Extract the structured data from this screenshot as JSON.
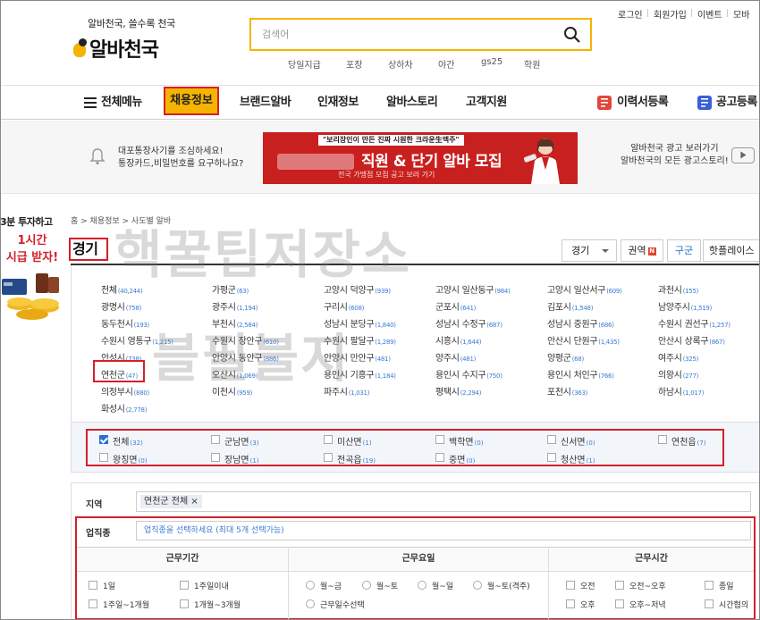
{
  "header": {
    "tagline": "알바천국, 쓸수록 천국",
    "logo_text": "알바천국",
    "search_placeholder": "검색어",
    "keywords": [
      "당일지급",
      "포장",
      "상하차",
      "야간",
      "gs25",
      "학원"
    ],
    "util_links": [
      "로그인",
      "회원가입",
      "이벤트",
      "모바"
    ]
  },
  "nav": {
    "menu_label": "전체메뉴",
    "items": [
      "채용정보",
      "브랜드알바",
      "인재정보",
      "알바스토리",
      "고객지원"
    ],
    "resume_label": "이력서등록",
    "post_label": "공고등록"
  },
  "banner": {
    "notice_line1": "대포통장사기를 조심하세요!",
    "notice_line2": "통장카드,비밀번호를 요구하나요?",
    "ad_top": "\"보리장인이 만든 진짜 시원한 크라운生맥주\"",
    "ad_main": "직원 & 단기 알바 모집",
    "ad_sub": "전국 가맹점 모집 공고 보러 가기",
    "right_line1": "알바천국 광고 보러가기",
    "right_line2": "알바천국의 모든 광고스토리!"
  },
  "side_ad": {
    "line1": "3분 투자하고",
    "line2": "1시간",
    "line3": "시급 받자!"
  },
  "breadcrumb": "홈 > 채용정보 > 사도별 알바",
  "page_title": "경기",
  "region_select": "경기",
  "tabs": [
    "권역",
    "구군",
    "핫플레이스"
  ],
  "tab_badge": "N",
  "cities": [
    [
      "전체",
      "40,244"
    ],
    [
      "가평군",
      "63"
    ],
    [
      "고양시 덕양구",
      "939"
    ],
    [
      "고양시 일산동구",
      "984"
    ],
    [
      "고양시 일산서구",
      "609"
    ],
    [
      "과천시",
      "155"
    ],
    [
      "광명시",
      "758"
    ],
    [
      "광주시",
      "1,194"
    ],
    [
      "구리시",
      "608"
    ],
    [
      "군포시",
      "641"
    ],
    [
      "김포시",
      "1,548"
    ],
    [
      "남양주시",
      "1,519"
    ],
    [
      "동두천시",
      "193"
    ],
    [
      "부천시",
      "2,584"
    ],
    [
      "성남시 분당구",
      "1,840"
    ],
    [
      "성남시 수정구",
      "687"
    ],
    [
      "성남시 중원구",
      "686"
    ],
    [
      "수원시 권선구",
      "1,257"
    ],
    [
      "수원시 영통구",
      "1,215"
    ],
    [
      "수원시 장안구",
      "610"
    ],
    [
      "수원시 팔달구",
      "1,289"
    ],
    [
      "시흥시",
      "1,644"
    ],
    [
      "안산시 단원구",
      "1,435"
    ],
    [
      "안산시 상록구",
      "867"
    ],
    [
      "안성시",
      "738"
    ],
    [
      "안양시 동안구",
      "886"
    ],
    [
      "안양시 만안구",
      "481"
    ],
    [
      "양주시",
      "481"
    ],
    [
      "양평군",
      "68"
    ],
    [
      "여주시",
      "325"
    ],
    [
      "연천군",
      "47"
    ],
    [
      "오산시",
      "1,069"
    ],
    [
      "용인시 기흥구",
      "1,184"
    ],
    [
      "용인시 수지구",
      "750"
    ],
    [
      "용인시 처인구",
      "766"
    ],
    [
      "의왕시",
      "277"
    ],
    [
      "의정부시",
      "880"
    ],
    [
      "이천시",
      "959"
    ],
    [
      "파주시",
      "1,031"
    ],
    [
      "평택시",
      "2,294"
    ],
    [
      "포천시",
      "363"
    ],
    [
      "하남시",
      "1,017"
    ],
    [
      "화성시",
      "2,778"
    ]
  ],
  "subtowns": [
    [
      "전체",
      "32"
    ],
    [
      "군남면",
      "3"
    ],
    [
      "미산면",
      "1"
    ],
    [
      "백학면",
      "0"
    ],
    [
      "신서면",
      "0"
    ],
    [
      "연천읍",
      "7"
    ],
    [
      "왕징면",
      "0"
    ],
    [
      "장남면",
      "1"
    ],
    [
      "전곡읍",
      "19"
    ],
    [
      "중면",
      "0"
    ],
    [
      "청산면",
      "1"
    ]
  ],
  "filter": {
    "region_label": "지역",
    "region_chip": "연천군 전체",
    "job_label": "업직종",
    "job_placeholder": "업직종을 선택하세요 (최대 5개 선택가능)",
    "col_period": "근무기간",
    "col_days": "근무요일",
    "col_time": "근무시간",
    "period_opts": [
      "1일",
      "1주일이내",
      "1주일~1개월",
      "1개월~3개월"
    ],
    "day_opts": [
      "월~금",
      "월~토",
      "월~일",
      "월~토(격주)",
      "근무일수선택"
    ],
    "time_opts": [
      "오전",
      "오전~오후",
      "종일",
      "오후",
      "오후~저녁",
      "시간협의"
    ]
  },
  "watermark_line1": "핵꿀팁저장소",
  "watermark_line2": "블필블지",
  "colors": {
    "brand": "#f5b400",
    "highlight": "#d4202a",
    "link_blue": "#3a7bd5"
  }
}
